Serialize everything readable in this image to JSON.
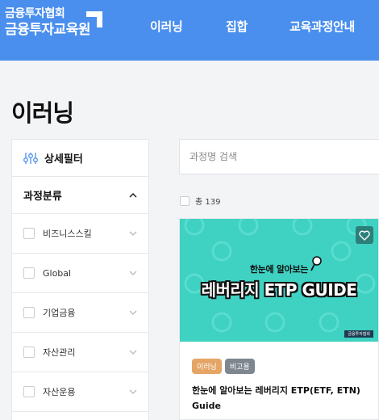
{
  "header": {
    "logo_line1": "금융투자협회",
    "logo_line2": "금융투자교육원",
    "nav": [
      "이러닝",
      "집합",
      "교육과정안내"
    ]
  },
  "page": {
    "title": "이러닝"
  },
  "sidebar": {
    "filter_label": "상세필터",
    "category_label": "과정분류",
    "categories": [
      "비즈니스스킬",
      "Global",
      "기업금융",
      "자산관리",
      "자산운용"
    ]
  },
  "search": {
    "placeholder": "과정명 검색",
    "value": ""
  },
  "results": {
    "count_label": "총 139"
  },
  "course": {
    "thumb_subtitle": "한눈에 알아보는",
    "thumb_title": "레버리지 ETP GUIDE",
    "thumb_logo": "금융투자협회",
    "tags": [
      "이러닝",
      "비고용"
    ],
    "title": "한눈에 알아보는 레버리지 ETP(ETF, ETN) Guide"
  },
  "colors": {
    "header": "#4a8fee",
    "thumb_bg": "#3fd1c2",
    "tag_orange": "#e4a566",
    "tag_gray": "#7e868f"
  },
  "icons": [
    "filter-sliders-icon",
    "chevron-up-icon",
    "chevron-down-icon",
    "heart-icon",
    "pin-icon"
  ]
}
